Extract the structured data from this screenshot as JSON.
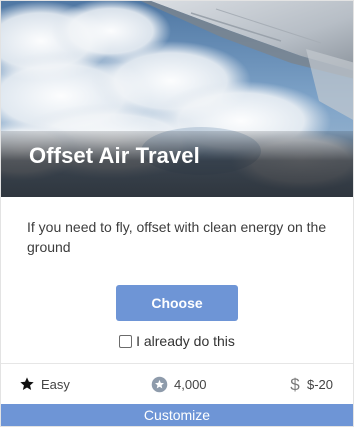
{
  "card": {
    "title": "Offset Air Travel",
    "description": "If you need to fly, offset with clean energy on the ground",
    "choose_label": "Choose",
    "already_label": "I already do this",
    "already_checked": false,
    "difficulty": {
      "icon": "star-icon",
      "label": "Easy"
    },
    "points": {
      "icon": "points-badge-icon",
      "label": "4,000"
    },
    "cost": {
      "icon": "dollar-icon",
      "label": "$-20"
    },
    "customize_label": "Customize",
    "hero_image": "airplane-wing-over-clouds"
  },
  "colors": {
    "accent": "#6e95d6",
    "text": "#3d3d3d"
  }
}
